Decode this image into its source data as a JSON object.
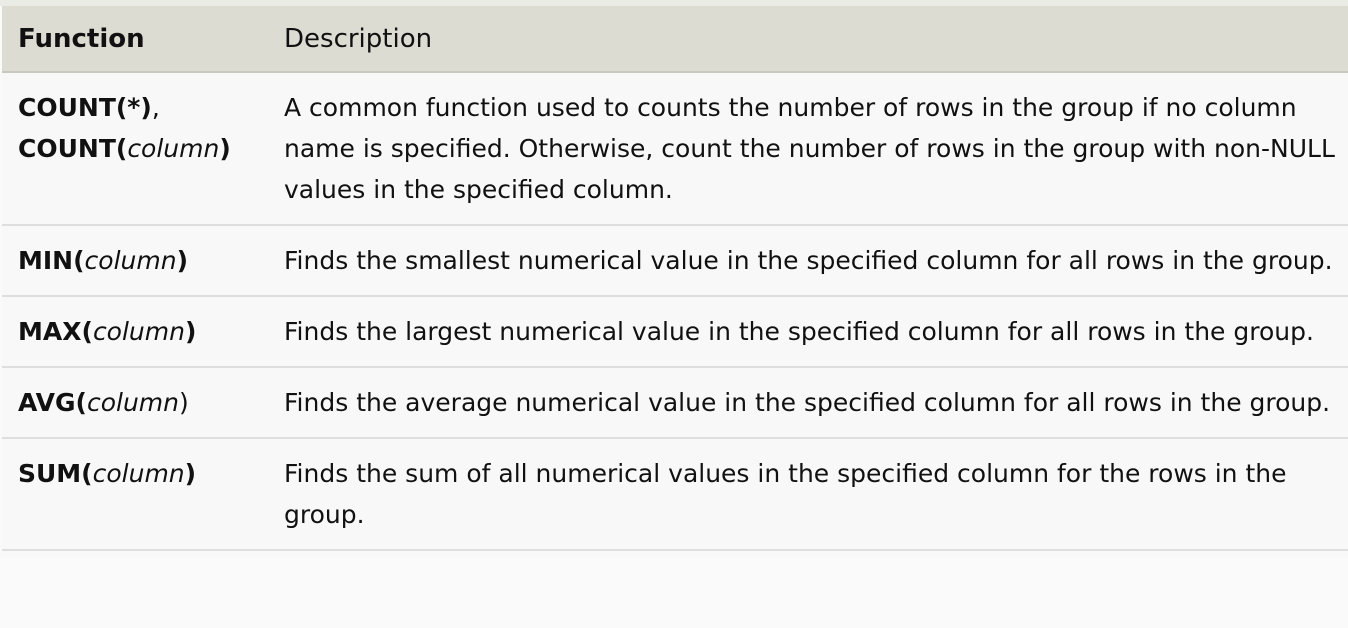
{
  "header": {
    "function": "Function",
    "description": "Description"
  },
  "rows": [
    {
      "parts": [
        {
          "text": "COUNT(*)",
          "style": "bold"
        },
        {
          "text": ",",
          "style": "normal"
        },
        {
          "text": "COUNT(",
          "style": "bold",
          "newline": true
        },
        {
          "text": "column",
          "style": "italic"
        },
        {
          "text": ")",
          "style": "bold"
        }
      ],
      "description": "A common function used to counts the number of rows in the group if no column name is specified. Otherwise, count the number of rows in the group with non-NULL values in the specified column."
    },
    {
      "parts": [
        {
          "text": "MIN(",
          "style": "bold"
        },
        {
          "text": "column",
          "style": "italic"
        },
        {
          "text": ")",
          "style": "bold"
        }
      ],
      "description": "Finds the smallest numerical value in the specified column for all rows in the group."
    },
    {
      "parts": [
        {
          "text": "MAX(",
          "style": "bold"
        },
        {
          "text": "column",
          "style": "italic"
        },
        {
          "text": ")",
          "style": "bold"
        }
      ],
      "description": "Finds the largest numerical value in the specified column for all rows in the group."
    },
    {
      "parts": [
        {
          "text": "AVG(",
          "style": "bold"
        },
        {
          "text": "column",
          "style": "italic"
        },
        {
          "text": ")",
          "style": "normal"
        }
      ],
      "description": "Finds the average numerical value in the specified column for all rows in the group."
    },
    {
      "parts": [
        {
          "text": "SUM(",
          "style": "bold"
        },
        {
          "text": "column",
          "style": "italic"
        },
        {
          "text": ")",
          "style": "bold"
        }
      ],
      "description": "Finds the sum of all numerical values in the specified column for the rows in the group."
    }
  ]
}
